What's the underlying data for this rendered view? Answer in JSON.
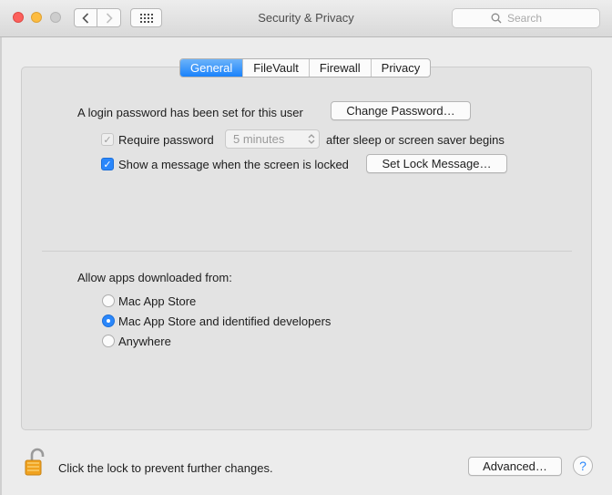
{
  "window": {
    "title": "Security & Privacy",
    "search_placeholder": "Search"
  },
  "toolbar": {
    "back_icon": "chevron-left-icon",
    "forward_icon": "chevron-right-icon",
    "grid_icon": "show-all-grid-icon"
  },
  "tabs": [
    {
      "label": "General",
      "active": true
    },
    {
      "label": "FileVault",
      "active": false
    },
    {
      "label": "Firewall",
      "active": false
    },
    {
      "label": "Privacy",
      "active": false
    }
  ],
  "general": {
    "login_password_text": "A login password has been set for this user",
    "change_password_label": "Change Password…",
    "require_password_label": "Require password",
    "require_password_checked": true,
    "require_password_disabled": true,
    "require_password_delay": "5 minutes",
    "after_sleep_text": "after sleep or screen saver begins",
    "show_message_label": "Show a message when the screen is locked",
    "show_message_checked": true,
    "set_lock_message_label": "Set Lock Message…"
  },
  "allow_apps": {
    "heading": "Allow apps downloaded from:",
    "options": [
      {
        "label": "Mac App Store",
        "selected": false
      },
      {
        "label": "Mac App Store and identified developers",
        "selected": true
      },
      {
        "label": "Anywhere",
        "selected": false
      }
    ]
  },
  "footer": {
    "lock_text": "Click the lock to prevent further changes.",
    "lock_icon": "unlocked-padlock-icon",
    "advanced_label": "Advanced…",
    "help_label": "?"
  },
  "colors": {
    "accent": "#2a87fb",
    "tab_active_top": "#6cb3fa",
    "tab_active_bottom": "#1a82fb",
    "close": "#fc605c",
    "minimize": "#fdbc40",
    "zoom_disabled": "#cdcdcd",
    "lock_gold": "#f0a21f"
  }
}
